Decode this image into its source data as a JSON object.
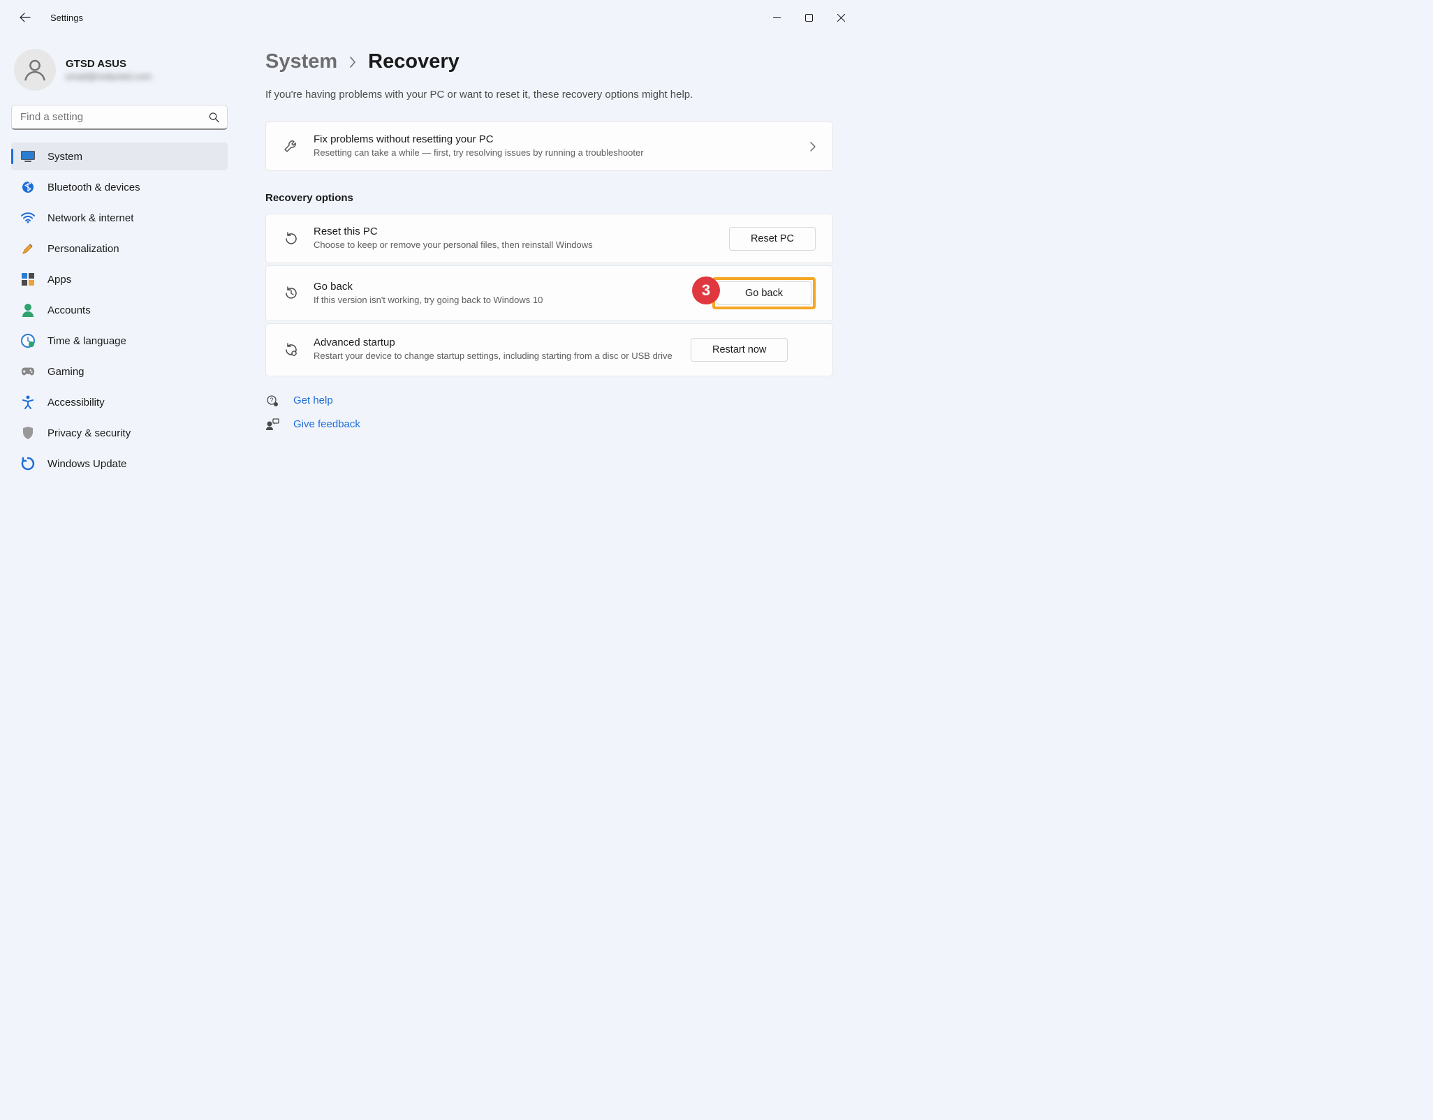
{
  "window": {
    "title": "Settings"
  },
  "profile": {
    "name": "GTSD ASUS",
    "email": "email@redacted.com"
  },
  "search": {
    "placeholder": "Find a setting"
  },
  "nav": {
    "items": [
      {
        "label": "System",
        "icon": "system"
      },
      {
        "label": "Bluetooth & devices",
        "icon": "bluetooth"
      },
      {
        "label": "Network & internet",
        "icon": "wifi"
      },
      {
        "label": "Personalization",
        "icon": "brush"
      },
      {
        "label": "Apps",
        "icon": "apps"
      },
      {
        "label": "Accounts",
        "icon": "person"
      },
      {
        "label": "Time & language",
        "icon": "clock"
      },
      {
        "label": "Gaming",
        "icon": "gamepad"
      },
      {
        "label": "Accessibility",
        "icon": "accessibility"
      },
      {
        "label": "Privacy & security",
        "icon": "shield"
      },
      {
        "label": "Windows Update",
        "icon": "update"
      }
    ]
  },
  "breadcrumb": {
    "parent": "System",
    "current": "Recovery"
  },
  "subtitle": "If you're having problems with your PC or want to reset it, these recovery options might help.",
  "fixproblems": {
    "title": "Fix problems without resetting your PC",
    "desc": "Resetting can take a while — first, try resolving issues by running a troubleshooter"
  },
  "section_label": "Recovery options",
  "reset": {
    "title": "Reset this PC",
    "desc": "Choose to keep or remove your personal files, then reinstall Windows",
    "button": "Reset PC"
  },
  "goback": {
    "title": "Go back",
    "desc": "If this version isn't working, try going back to Windows 10",
    "button": "Go back"
  },
  "advanced": {
    "title": "Advanced startup",
    "desc": "Restart your device to change startup settings, including starting from a disc or USB drive",
    "button": "Restart now"
  },
  "links": {
    "help": "Get help",
    "feedback": "Give feedback"
  },
  "callout": {
    "number": "3"
  }
}
